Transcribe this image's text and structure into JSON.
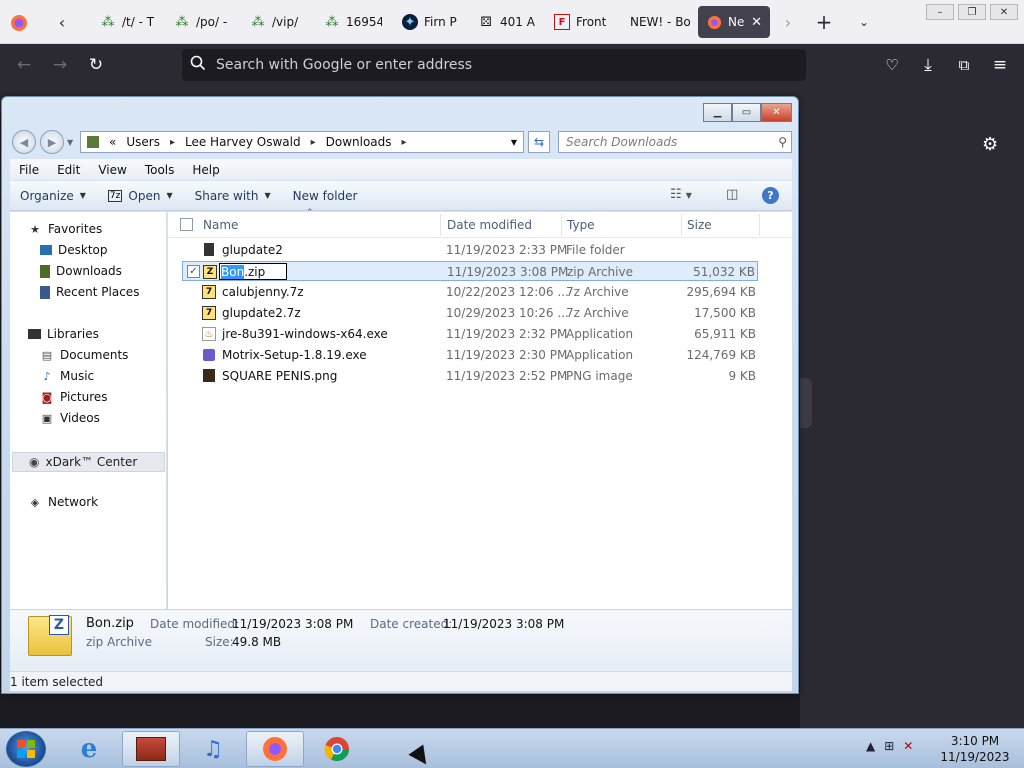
{
  "browser": {
    "tabs": [
      {
        "title": "/t/ - T",
        "icon": "clover-icon"
      },
      {
        "title": "/po/ -",
        "icon": "clover-icon"
      },
      {
        "title": "/vip/",
        "icon": "clover-icon"
      },
      {
        "title": "16954",
        "icon": "clover-icon"
      },
      {
        "title": "Firn P",
        "icon": "star-logo-icon"
      },
      {
        "title": "401 A",
        "icon": "dice-icon"
      },
      {
        "title": "Front",
        "icon": "frame-icon"
      },
      {
        "title": "NEW! - Bo",
        "icon": ""
      },
      {
        "title": "Ne",
        "icon": "firefox-icon",
        "active": true
      }
    ],
    "url_placeholder": "Search with Google or enter address",
    "window_buttons": [
      "–",
      "❐",
      "✕"
    ]
  },
  "explorer": {
    "breadcrumb": [
      "«",
      "Users",
      "Lee Harvey Oswald",
      "Downloads"
    ],
    "search_placeholder": "Search Downloads",
    "menu": [
      "File",
      "Edit",
      "View",
      "Tools",
      "Help"
    ],
    "commands": {
      "organize": "Organize",
      "open": "Open",
      "share_with": "Share with",
      "new_folder": "New folder"
    },
    "sidebar": {
      "favorites": {
        "label": "Favorites",
        "items": [
          "Desktop",
          "Downloads",
          "Recent Places"
        ]
      },
      "libraries": {
        "label": "Libraries",
        "items": [
          "Documents",
          "Music",
          "Pictures",
          "Videos"
        ]
      },
      "homegroup": "xDark™ Center",
      "network": "Network"
    },
    "columns": {
      "name": "Name",
      "date": "Date modified",
      "type": "Type",
      "size": "Size"
    },
    "files": [
      {
        "name": "glupdate2",
        "date": "11/19/2023 2:33 PM",
        "type": "File folder",
        "size": ""
      },
      {
        "name": "Bon.zip",
        "date": "11/19/2023 3:08 PM",
        "type": "zip Archive",
        "size": "51,032 KB",
        "selected": true
      },
      {
        "name": "calubjenny.7z",
        "date": "10/22/2023 12:06 ...",
        "type": "7z Archive",
        "size": "295,694 KB"
      },
      {
        "name": "glupdate2.7z",
        "date": "10/29/2023 10:26 ...",
        "type": "7z Archive",
        "size": "17,500 KB"
      },
      {
        "name": "jre-8u391-windows-x64.exe",
        "date": "11/19/2023 2:32 PM",
        "type": "Application",
        "size": "65,911 KB"
      },
      {
        "name": "Motrix-Setup-1.8.19.exe",
        "date": "11/19/2023 2:30 PM",
        "type": "Application",
        "size": "124,769 KB"
      },
      {
        "name": "SQUARE PENIS.png",
        "date": "11/19/2023 2:52 PM",
        "type": "PNG image",
        "size": "9 KB"
      }
    ],
    "rename": {
      "highlighted": "Bon",
      "rest": ".zip"
    },
    "details": {
      "name": "Bon.zip",
      "type": "zip Archive",
      "date_modified_label": "Date modified:",
      "date_modified": "11/19/2023 3:08 PM",
      "date_created_label": "Date created:",
      "date_created": "11/19/2023 3:08 PM",
      "size_label": "Size:",
      "size": "49.8 MB"
    },
    "status": "1 item selected"
  },
  "taskbar": {
    "clock_time": "3:10 PM",
    "clock_date": "11/19/2023"
  }
}
